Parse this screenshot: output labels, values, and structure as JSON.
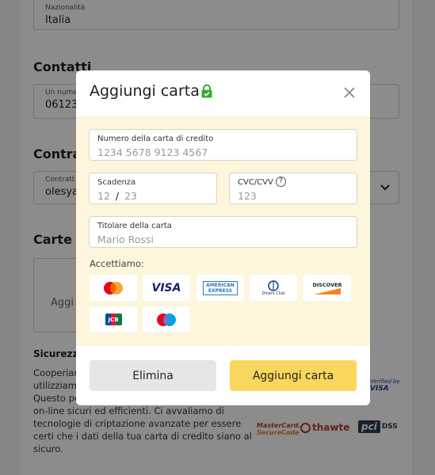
{
  "background": {
    "nationality": {
      "label": "Nazionalità",
      "value": "Italia"
    },
    "contacts_heading": "Contatti",
    "phone": {
      "label": "Un nume",
      "value": "061234"
    },
    "contract_heading": "Contrat",
    "contract": {
      "label": "Contratt",
      "value": "olesyava"
    },
    "cards_heading": "Carte d",
    "cards_add_label": "Aggi",
    "security_heading": "Sicurezz",
    "security_lines": [
      "Cooperiam",
      "utilizziamo",
      "Questo pe",
      "on-line sicuri ed efficienti. Ci avvaliamo di",
      "tecnologie di criptazione avanzate per essere",
      "certi che i dati della tua carta di credito siano al",
      "sicuro."
    ],
    "trust_badges": {
      "verified_by": "Verified by",
      "visa": "VISA",
      "mastercard_1": "MasterCard.",
      "mastercard_2": "SecureCode",
      "thawte": "thawte",
      "pci": "pci",
      "dss": "DSS"
    }
  },
  "modal": {
    "title": "Aggiungi carta",
    "card_number": {
      "label": "Numero della carta di credito",
      "placeholder": "1234 5678 9123 4567"
    },
    "expiry": {
      "label": "Scadenza",
      "month": "12",
      "separator": "/",
      "year": "23"
    },
    "cvc": {
      "label": "CVC/CVV",
      "help": "?",
      "placeholder": "123"
    },
    "holder": {
      "label": "Titolare della carta",
      "placeholder": "Mario Rossi"
    },
    "accept_label": "Accettiamo:",
    "card_brands": {
      "visa": "VISA",
      "amex_1": "AMERICAN",
      "amex_2": "EXPRESS",
      "diners": "Diners Club",
      "discover": "DISCOVER",
      "jcb": "JCB"
    },
    "delete_button": "Elimina",
    "add_button": "Aggiungi carta"
  },
  "colors": {
    "accent": "#f9d75d",
    "modal_body": "#fdf6dc",
    "lock": "#3aa835"
  }
}
